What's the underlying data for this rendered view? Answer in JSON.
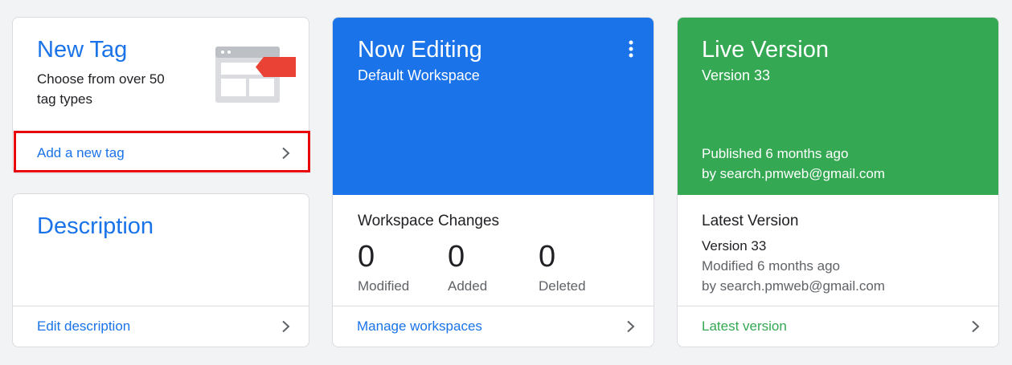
{
  "new_tag": {
    "title": "New Tag",
    "desc_line1": "Choose from over 50",
    "desc_line2": "tag types",
    "link": "Add a new tag",
    "icon": "tag-browser-icon"
  },
  "description": {
    "title": "Description",
    "link": "Edit description"
  },
  "now_editing": {
    "title": "Now Editing",
    "workspace": "Default Workspace",
    "header_color": "#1a73e8",
    "changes_title": "Workspace Changes",
    "stats": [
      {
        "value": "0",
        "label": "Modified"
      },
      {
        "value": "0",
        "label": "Added"
      },
      {
        "value": "0",
        "label": "Deleted"
      }
    ],
    "link": "Manage workspaces",
    "menu_icon": "more-vert-icon"
  },
  "live_version": {
    "title": "Live Version",
    "version": "Version 33",
    "header_color": "#34a853",
    "published": "Published 6 months ago",
    "published_by": "by search.pmweb@gmail.com",
    "latest_title": "Latest Version",
    "latest_version": "Version 33",
    "modified": "Modified 6 months ago",
    "modified_by": "by search.pmweb@gmail.com",
    "link": "Latest version"
  },
  "highlight_color": "#e8000b"
}
